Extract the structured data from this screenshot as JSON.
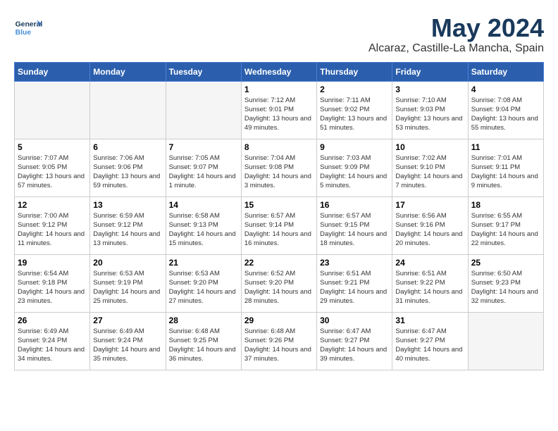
{
  "header": {
    "logo_general": "General",
    "logo_blue": "Blue",
    "month": "May 2024",
    "location": "Alcaraz, Castille-La Mancha, Spain"
  },
  "days_of_week": [
    "Sunday",
    "Monday",
    "Tuesday",
    "Wednesday",
    "Thursday",
    "Friday",
    "Saturday"
  ],
  "weeks": [
    [
      {
        "day": "",
        "empty": true
      },
      {
        "day": "",
        "empty": true
      },
      {
        "day": "",
        "empty": true
      },
      {
        "day": "1",
        "sunrise": "7:12 AM",
        "sunset": "9:01 PM",
        "daylight": "13 hours and 49 minutes."
      },
      {
        "day": "2",
        "sunrise": "7:11 AM",
        "sunset": "9:02 PM",
        "daylight": "13 hours and 51 minutes."
      },
      {
        "day": "3",
        "sunrise": "7:10 AM",
        "sunset": "9:03 PM",
        "daylight": "13 hours and 53 minutes."
      },
      {
        "day": "4",
        "sunrise": "7:08 AM",
        "sunset": "9:04 PM",
        "daylight": "13 hours and 55 minutes."
      }
    ],
    [
      {
        "day": "5",
        "sunrise": "7:07 AM",
        "sunset": "9:05 PM",
        "daylight": "13 hours and 57 minutes."
      },
      {
        "day": "6",
        "sunrise": "7:06 AM",
        "sunset": "9:06 PM",
        "daylight": "13 hours and 59 minutes."
      },
      {
        "day": "7",
        "sunrise": "7:05 AM",
        "sunset": "9:07 PM",
        "daylight": "14 hours and 1 minute."
      },
      {
        "day": "8",
        "sunrise": "7:04 AM",
        "sunset": "9:08 PM",
        "daylight": "14 hours and 3 minutes."
      },
      {
        "day": "9",
        "sunrise": "7:03 AM",
        "sunset": "9:09 PM",
        "daylight": "14 hours and 5 minutes."
      },
      {
        "day": "10",
        "sunrise": "7:02 AM",
        "sunset": "9:10 PM",
        "daylight": "14 hours and 7 minutes."
      },
      {
        "day": "11",
        "sunrise": "7:01 AM",
        "sunset": "9:11 PM",
        "daylight": "14 hours and 9 minutes."
      }
    ],
    [
      {
        "day": "12",
        "sunrise": "7:00 AM",
        "sunset": "9:12 PM",
        "daylight": "14 hours and 11 minutes."
      },
      {
        "day": "13",
        "sunrise": "6:59 AM",
        "sunset": "9:12 PM",
        "daylight": "14 hours and 13 minutes."
      },
      {
        "day": "14",
        "sunrise": "6:58 AM",
        "sunset": "9:13 PM",
        "daylight": "14 hours and 15 minutes."
      },
      {
        "day": "15",
        "sunrise": "6:57 AM",
        "sunset": "9:14 PM",
        "daylight": "14 hours and 16 minutes."
      },
      {
        "day": "16",
        "sunrise": "6:57 AM",
        "sunset": "9:15 PM",
        "daylight": "14 hours and 18 minutes."
      },
      {
        "day": "17",
        "sunrise": "6:56 AM",
        "sunset": "9:16 PM",
        "daylight": "14 hours and 20 minutes."
      },
      {
        "day": "18",
        "sunrise": "6:55 AM",
        "sunset": "9:17 PM",
        "daylight": "14 hours and 22 minutes."
      }
    ],
    [
      {
        "day": "19",
        "sunrise": "6:54 AM",
        "sunset": "9:18 PM",
        "daylight": "14 hours and 23 minutes."
      },
      {
        "day": "20",
        "sunrise": "6:53 AM",
        "sunset": "9:19 PM",
        "daylight": "14 hours and 25 minutes."
      },
      {
        "day": "21",
        "sunrise": "6:53 AM",
        "sunset": "9:20 PM",
        "daylight": "14 hours and 27 minutes."
      },
      {
        "day": "22",
        "sunrise": "6:52 AM",
        "sunset": "9:20 PM",
        "daylight": "14 hours and 28 minutes."
      },
      {
        "day": "23",
        "sunrise": "6:51 AM",
        "sunset": "9:21 PM",
        "daylight": "14 hours and 29 minutes."
      },
      {
        "day": "24",
        "sunrise": "6:51 AM",
        "sunset": "9:22 PM",
        "daylight": "14 hours and 31 minutes."
      },
      {
        "day": "25",
        "sunrise": "6:50 AM",
        "sunset": "9:23 PM",
        "daylight": "14 hours and 32 minutes."
      }
    ],
    [
      {
        "day": "26",
        "sunrise": "6:49 AM",
        "sunset": "9:24 PM",
        "daylight": "14 hours and 34 minutes."
      },
      {
        "day": "27",
        "sunrise": "6:49 AM",
        "sunset": "9:24 PM",
        "daylight": "14 hours and 35 minutes."
      },
      {
        "day": "28",
        "sunrise": "6:48 AM",
        "sunset": "9:25 PM",
        "daylight": "14 hours and 36 minutes."
      },
      {
        "day": "29",
        "sunrise": "6:48 AM",
        "sunset": "9:26 PM",
        "daylight": "14 hours and 37 minutes."
      },
      {
        "day": "30",
        "sunrise": "6:47 AM",
        "sunset": "9:27 PM",
        "daylight": "14 hours and 39 minutes."
      },
      {
        "day": "31",
        "sunrise": "6:47 AM",
        "sunset": "9:27 PM",
        "daylight": "14 hours and 40 minutes."
      },
      {
        "day": "",
        "empty": true
      }
    ]
  ]
}
